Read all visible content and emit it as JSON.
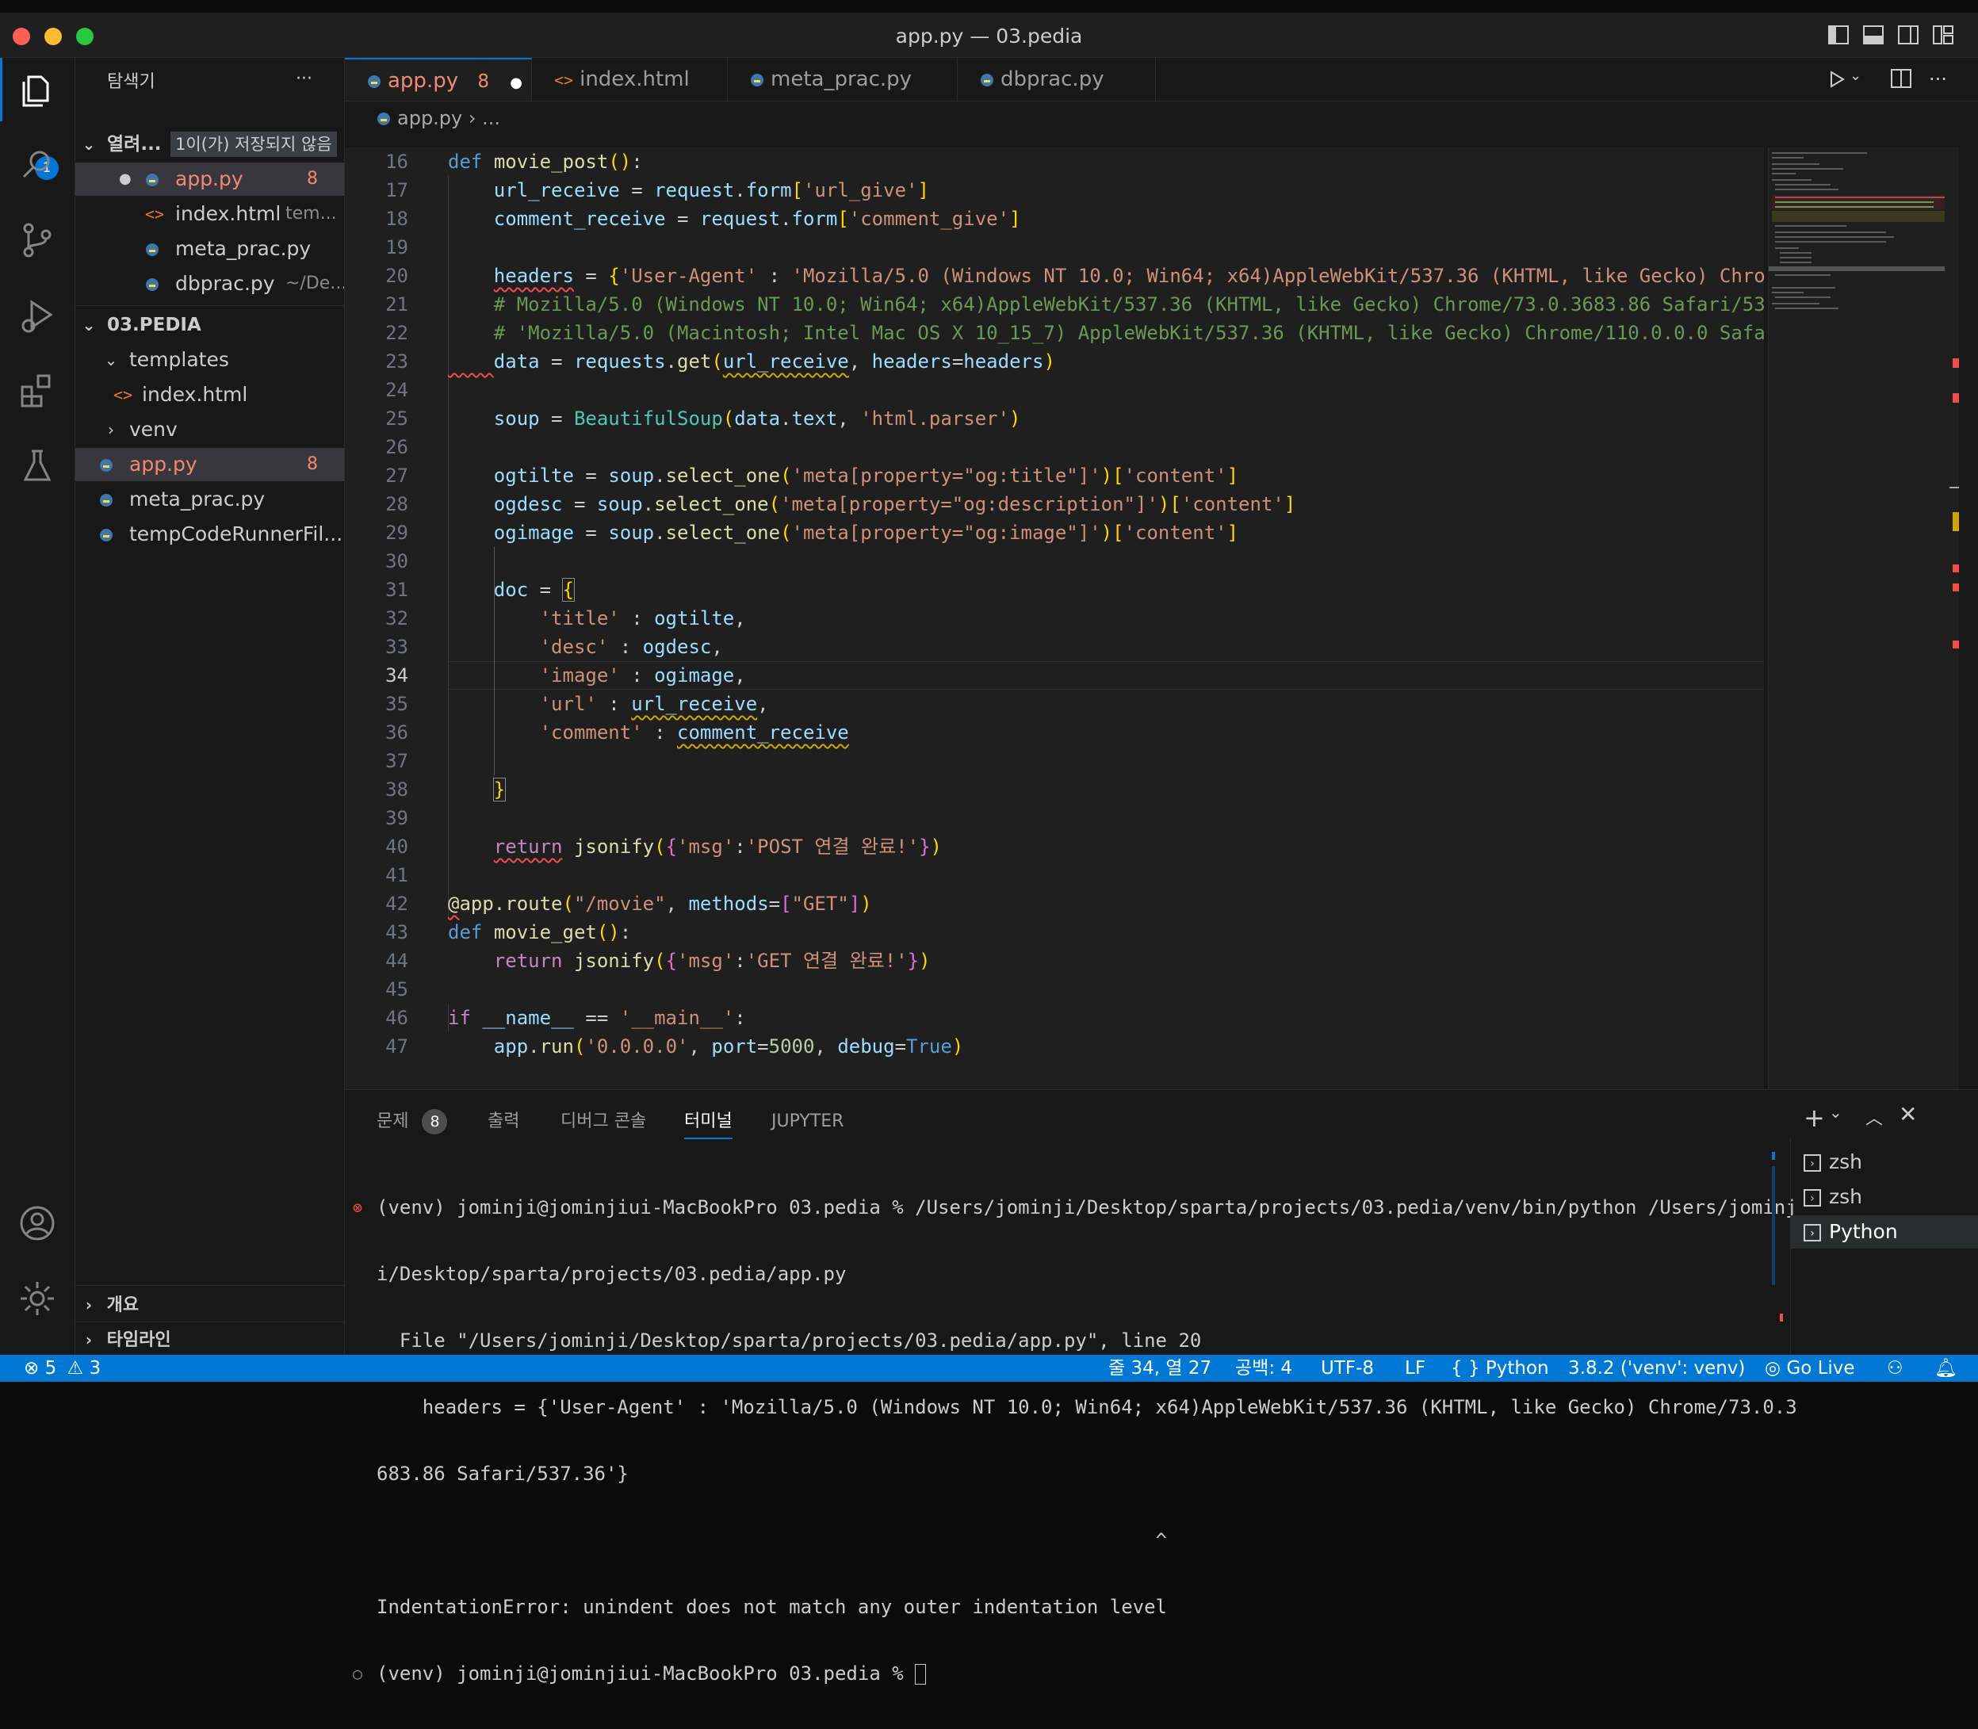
{
  "window": {
    "title": "app.py — 03.pedia"
  },
  "activity": {
    "explorer_badge": "1"
  },
  "sidebar": {
    "title": "탐색기",
    "more": "···",
    "open_editors": {
      "label": "열려...",
      "unsaved": "1이(가) 저장되지 않음"
    },
    "open_files": [
      {
        "name": "app.py",
        "detail": "",
        "badge": "8"
      },
      {
        "name": "index.html",
        "detail": "tem...",
        "badge": ""
      },
      {
        "name": "meta_prac.py",
        "detail": "",
        "badge": ""
      },
      {
        "name": "dbprac.py",
        "detail": "~/De...",
        "badge": ""
      }
    ],
    "project": "03.PEDIA",
    "tree": {
      "templates": "templates",
      "index_html": "index.html",
      "venv": "venv",
      "app_py": "app.py",
      "app_py_badge": "8",
      "meta_prac": "meta_prac.py",
      "temp": "tempCodeRunnerFil..."
    },
    "outline": "개요",
    "timeline": "타임라인"
  },
  "tabs": [
    {
      "label": "app.py",
      "badge": "8"
    },
    {
      "label": "index.html"
    },
    {
      "label": "meta_prac.py"
    },
    {
      "label": "dbprac.py"
    }
  ],
  "breadcrumb": {
    "file": "app.py",
    "rest": "..."
  },
  "editor": {
    "line_numbers": [
      "16",
      "17",
      "18",
      "19",
      "20",
      "21",
      "22",
      "23",
      "24",
      "25",
      "26",
      "27",
      "28",
      "29",
      "30",
      "31",
      "32",
      "33",
      "34",
      "35",
      "36",
      "37",
      "38",
      "39",
      "40",
      "41",
      "42",
      "43",
      "44",
      "45",
      "46",
      "47"
    ]
  },
  "panel": {
    "tabs": [
      "문제",
      "출력",
      "디버그 콘솔",
      "터미널",
      "JUPYTER"
    ],
    "problems_count": "8",
    "terminal_lines": [
      "(venv) jominji@jominjiui-MacBookPro 03.pedia % /Users/jominji/Desktop/sparta/projects/03.pedia/venv/bin/python /Users/jominj",
      "i/Desktop/sparta/projects/03.pedia/app.py",
      "  File \"/Users/jominji/Desktop/sparta/projects/03.pedia/app.py\", line 20",
      "    headers = {'User-Agent' : 'Mozilla/5.0 (Windows NT 10.0; Win64; x64)AppleWebKit/537.36 (KHTML, like Gecko) Chrome/73.0.3",
      "683.86 Safari/537.36'}",
      "                                                                    ^",
      "IndentationError: unindent does not match any outer indentation level",
      "(venv) jominji@jominjiui-MacBookPro 03.pedia % "
    ],
    "terminals": [
      "zsh",
      "zsh",
      "Python"
    ]
  },
  "status": {
    "errors": "5",
    "warnings": "3",
    "position": "줄 34, 열 27",
    "spaces": "공백: 4",
    "encoding": "UTF-8",
    "eol": "LF",
    "language": "Python",
    "interpreter": "3.8.2 ('venv': venv)",
    "golive": "Go Live"
  }
}
